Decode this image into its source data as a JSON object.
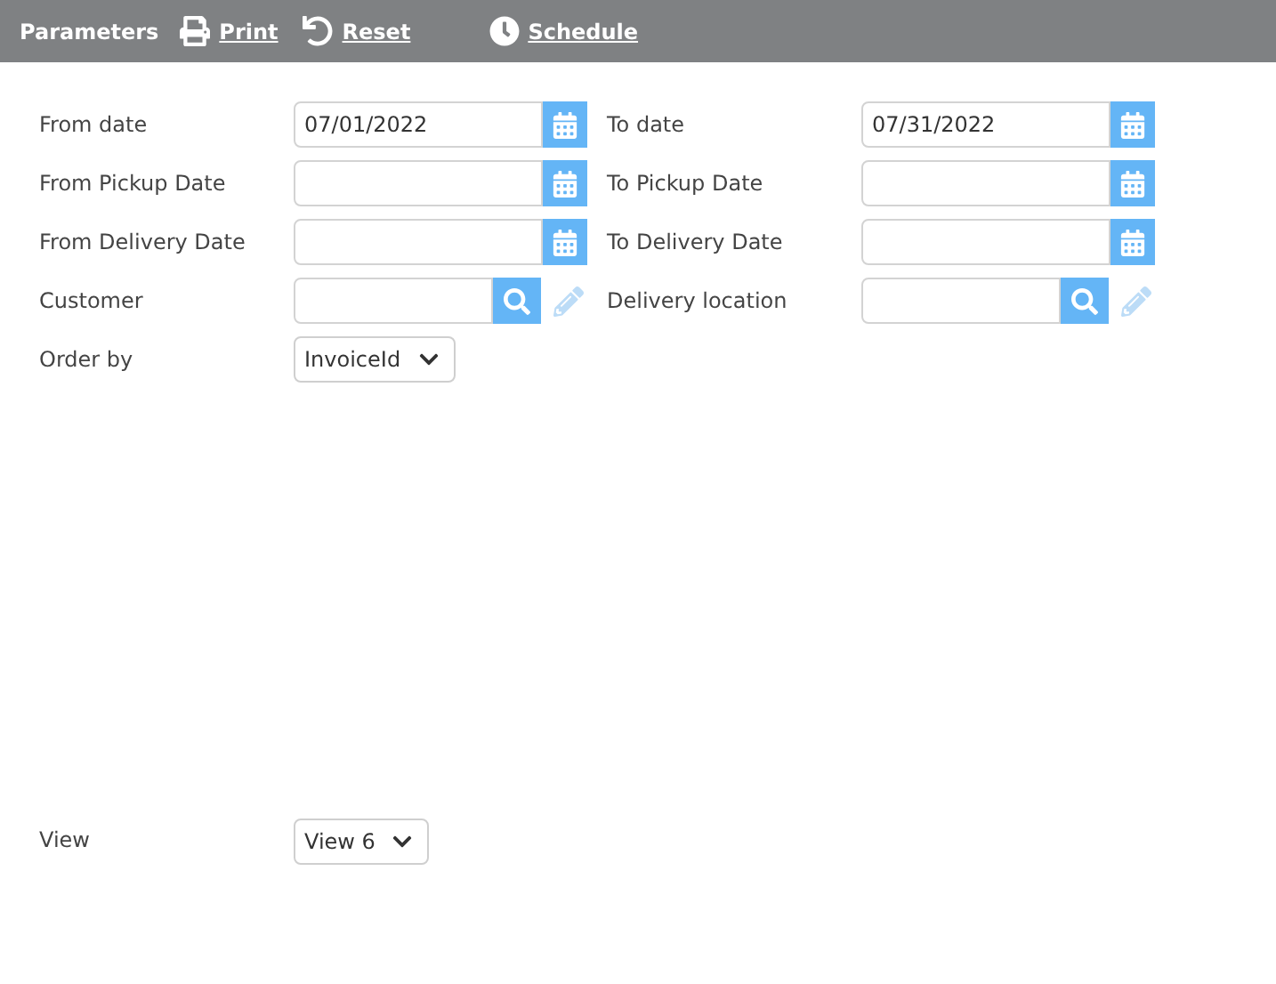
{
  "toolbar": {
    "title": "Parameters",
    "actions": [
      {
        "kind": "print",
        "label": "Print"
      },
      {
        "kind": "reset",
        "label": "Reset"
      },
      {
        "kind": "schedule",
        "label": "Schedule"
      }
    ]
  },
  "rows": [
    {
      "left": {
        "label": "From date",
        "kind": "date",
        "value": "07/01/2022"
      },
      "right": {
        "label": "To date",
        "kind": "date",
        "value": "07/31/2022"
      }
    },
    {
      "left": {
        "label": "From Pickup Date",
        "kind": "date"
      },
      "right": {
        "label": "To Pickup Date",
        "kind": "date"
      }
    },
    {
      "left": {
        "label": "From Delivery Date",
        "kind": "date"
      },
      "right": {
        "label": "To Delivery Date",
        "kind": "date"
      }
    },
    {
      "left": {
        "label": "Customer",
        "kind": "lookup"
      },
      "right": {
        "label": "Delivery location",
        "kind": "lookup"
      }
    },
    {
      "left": {
        "label": "Order by",
        "kind": "select",
        "value": "InvoiceId"
      }
    }
  ],
  "view": {
    "label": "View",
    "value": "View 6"
  }
}
